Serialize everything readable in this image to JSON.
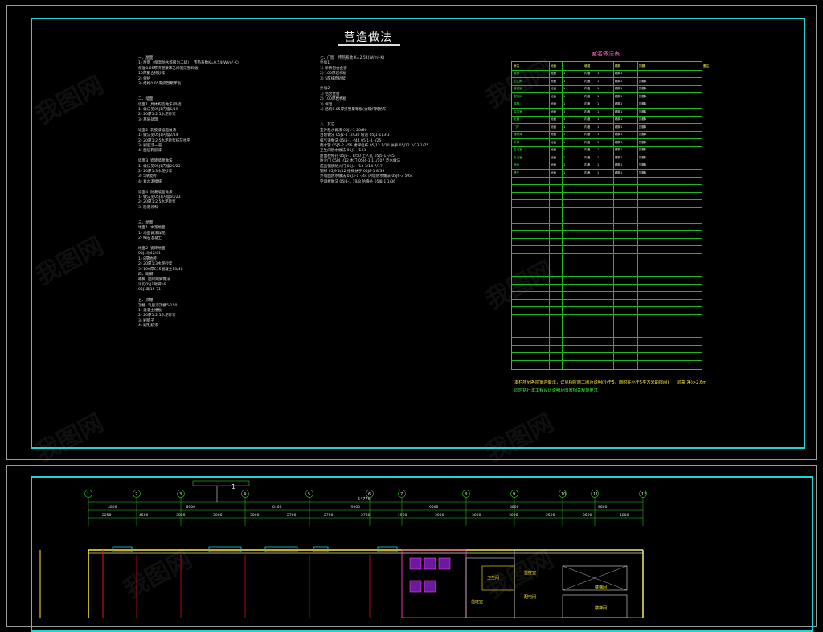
{
  "sheet1": {
    "title": "营造做法",
    "col1_text": "一、屋面\n1) 屋面（保温防水等级为二级）  传热系数K=0.54(W/m²·K)\n保温0.05厚挤塑聚苯乙烯泡沫塑料板\n10厚聚合物砂浆\n2) 保护\n3) 结构0.05厚挤塑聚苯板\n\n\n二、墙面\n墙面1  具体构造做法(外墙)\n1) 做法见05J1内墙5/19\n2) 20厚1:2.5水泥砂浆\n3) 基层处理\n\n墙面2  乳胶漆墙面做法\n1) 做法见05J1内墙2/14\n2) 20厚1:2.5水泥砂浆抹灰找平\n3) 刷底漆一道\n4) 面层乳胶漆\n\n墙面3  瓷砖墙面做法\n1) 做法见05J1内墙20/23\n2) 20厚1:3水泥砂浆\n3) 5厚瓷砖\n4) 素水泥擦缝\n\n墙面4  防潮墙面做法\n1) 做法见05J1内墙60/23\n2) 20厚1:2.5水泥砂浆\n3) 防潮涂料\n\n\n三、地面\n地面1  水泥地面\n1) 地面做法详见\n2) 细石混凝土\n\n地面2  瓷砖地面\n05J1地42/41\n1) 8厚地砖\n2) 20厚1:3水泥砂浆\n3) 100厚C15混凝土10/40\n四、踢脚\n踢脚  面砖踢脚做法\n详见05J1踢脚16\n05J1踢15-71\n\n五、顶棚\n顶棚  乳胶漆顶棚5-150\n1) 混凝土楼板\n2) 20厚1:2.5水泥砂浆\n3) 刷腻子\n4) 刷乳胶漆",
    "col2_text": "七、门窗   传热系数 K=2.54(W/m²·K)\n外墙1\n1) 断桥铝合金窗\n2) 100厚岩棉板\n3) 5厚抹面砂浆\n\n外墙2\n1) 铝合金窗\n2) 100厚岩棉板\n3) 保温\n4) 结构0.05厚挤塑聚苯板(含玻纤网格布)\n\n\n八、其它\n室外散水做法 05J1-1 20/86\n台阶做法 05J1-1 1/A30 坡道 05J1-113-1\n排气道做法 05J5-1 -/44 05J1-1 -/25\n雨水管 05J5-2 -/56 楼梯栏杆 05J12 1/10 扶手 05J12 2/73 1/75\n卫生间防水做法 05J1 -/123\n屋面检修孔 05J5-1 8/50 上人孔 05J5-1 -/45\n防火门 05J4 -/12 木门 05J4-1 11/107 泛水做法\n成品钢质防火门 05J4 -/13 3/14 7/17\n钢梯 05J9 2/12 楼梯扶手 05J8-1 8/39\n外墙面防水做法 05J3-1 -/44 内墙防水做法 05J6-3 5/64\n空调板做法 05J3-1 19/8 防滑条 05J8-1 1/36"
  },
  "table": {
    "title": "室名做法表",
    "headers": [
      "房名",
      "地面",
      "",
      "墙裙",
      "",
      "踢脚",
      "顶棚",
      "备注"
    ],
    "rows": [
      [
        "库房",
        "地面",
        "1",
        "内墙",
        "1",
        "踢脚1",
        "",
        ""
      ],
      [
        "卫生间",
        "地面",
        "1",
        "内墙",
        "1",
        "踢脚1",
        "顶棚1",
        ""
      ],
      [
        "值班室",
        "地面",
        "1",
        "内墙",
        "1",
        "踢脚1",
        "顶棚1",
        ""
      ],
      [
        "配电间",
        "地面",
        "1",
        "内墙",
        "1",
        "踢脚1",
        "顶棚1",
        ""
      ],
      [
        "楼梯",
        "地面",
        "1",
        "内墙",
        "1",
        "踢脚1",
        "顶棚1",
        ""
      ],
      [
        "监控室",
        "地面",
        "1",
        "内墙",
        "1",
        "踢脚1",
        "顶棚1",
        ""
      ],
      [
        "走廊",
        "地面",
        "1",
        "内墙",
        "1",
        "踢脚1",
        "顶棚1",
        ""
      ],
      [
        "门厅",
        "地面",
        "1",
        "内墙",
        "1",
        "踢脚1",
        "顶棚1",
        ""
      ],
      [
        "器材库",
        "地面",
        "1",
        "内墙",
        "1",
        "踢脚1",
        "顶棚1",
        ""
      ],
      [
        "车库",
        "地面",
        "1",
        "内墙",
        "1",
        "踢脚1",
        "顶棚1",
        ""
      ],
      [
        "会议室",
        "地面",
        "1",
        "内墙",
        "1",
        "踢脚1",
        "顶棚1",
        ""
      ],
      [
        "办公室",
        "地面",
        "1",
        "内墙",
        "1",
        "踢脚1",
        "顶棚1",
        ""
      ],
      [
        "宿舍",
        "地面",
        "1",
        "内墙",
        "1",
        "踢脚1",
        "顶棚1",
        ""
      ],
      [
        "餐厅",
        "地面",
        "1",
        "内墙",
        "1",
        "踢脚1",
        "顶棚1",
        ""
      ]
    ],
    "note1": "本栏所列各层室内做法，详见相应施工图及说明(小于5，面积在小于5平方米的房间)      层高(净)>2.6m",
    "note2": "同时执行本工程设计说明及国家相关规范要求"
  },
  "plan": {
    "total_dim": "54775",
    "dims_top": [
      "4800",
      "8000",
      "8400",
      "9000",
      "9000",
      "8600",
      "6800"
    ],
    "dims_second": [
      "2250",
      "4500",
      "3000",
      "3000",
      "3000",
      "2700",
      "2700",
      "2700",
      "1500",
      "3000",
      "3000",
      "3000",
      "2500",
      "3600",
      "1800"
    ],
    "axes": [
      "1",
      "2",
      "3",
      "4",
      "5",
      "6",
      "7",
      "8",
      "9",
      "10",
      "11",
      "12"
    ],
    "labels": [
      "1",
      "楼梯间",
      "楼梯间",
      "卫生间",
      "值班室",
      "监控室",
      "配电间"
    ]
  },
  "watermark": "我图网",
  "colors": {
    "frame": "#21d4d4",
    "table_line": "#1fb81f",
    "room_name": "#24ff24",
    "note": "#ffee33",
    "magenta": "#ff44dd",
    "red": "#e01818"
  }
}
